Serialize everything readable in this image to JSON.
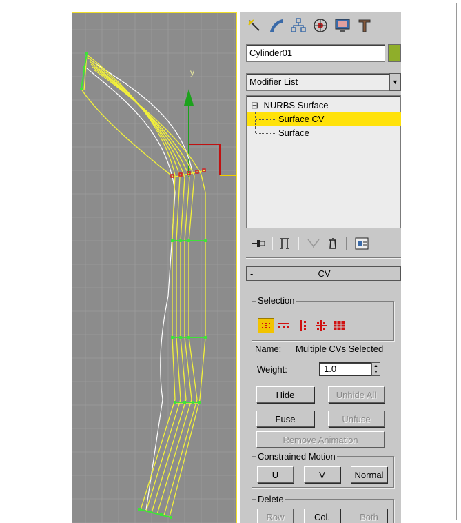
{
  "object_name": "Cylinder01",
  "object_color": "#8fae2a",
  "modifier_list": {
    "value": "Modifier List"
  },
  "toolbar_icons": [
    "create-icon",
    "modify-icon",
    "hierarchy-icon",
    "motion-icon",
    "display-icon",
    "utilities-icon"
  ],
  "modifier_stack": {
    "root": {
      "expander": "⊟",
      "label": "NURBS Surface"
    },
    "items": [
      {
        "label": "Surface CV",
        "selected": true
      },
      {
        "label": "Surface",
        "selected": false
      }
    ]
  },
  "stack_tools": [
    "pin-stack-icon",
    "show-end-result-icon",
    "make-unique-icon",
    "remove-modifier-icon",
    "configure-modifier-sets-icon"
  ],
  "rollout": {
    "collapse": "-",
    "title": "CV",
    "selection": {
      "label": "Selection",
      "levels": [
        "single-cv",
        "row-of-cvs",
        "column-of-cvs",
        "row-and-column",
        "all-cvs"
      ],
      "active_level": "single-cv"
    },
    "name_label": "Name:",
    "name_value": "Multiple CVs Selected",
    "weight_label": "Weight:",
    "weight_value": "1.0",
    "buttons": {
      "hide": "Hide",
      "unhide_all": "Unhide All",
      "fuse": "Fuse",
      "unfuse": "Unfuse",
      "remove_animation": "Remove Animation"
    },
    "constrained_motion": {
      "label": "Constrained Motion",
      "u": "U",
      "v": "V",
      "normal": "Normal"
    },
    "delete": {
      "label": "Delete",
      "row": "Row",
      "col": "Col.",
      "both": "Both"
    }
  },
  "viewport": {
    "gizmo_axis_label": "y",
    "colors": {
      "background": "#8c8c8c",
      "wire": "#f3f13a",
      "cv": "#3fe23a",
      "y_axis": "#1ca21c",
      "x_axis": "#c01010",
      "border": "#f1e02a"
    }
  }
}
